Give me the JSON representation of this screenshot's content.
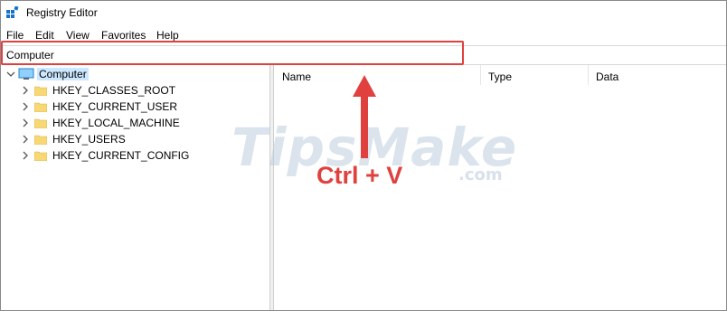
{
  "window": {
    "title": "Registry Editor"
  },
  "menu": {
    "items": [
      "File",
      "Edit",
      "View",
      "Favorites",
      "Help"
    ]
  },
  "address": {
    "value": "Computer"
  },
  "tree": {
    "root_label": "Computer",
    "keys": [
      "HKEY_CLASSES_ROOT",
      "HKEY_CURRENT_USER",
      "HKEY_LOCAL_MACHINE",
      "HKEY_USERS",
      "HKEY_CURRENT_CONFIG"
    ]
  },
  "list": {
    "columns": [
      "Name",
      "Type",
      "Data"
    ]
  },
  "annotation": {
    "text": "Ctrl + V"
  },
  "watermark": {
    "brand": "TipsMake",
    "domain": ".com"
  },
  "colors": {
    "highlight": "#e0413f",
    "selection": "#cce8ff",
    "folder": "#f8d775"
  },
  "icons": {
    "app": "registry-editor-icon",
    "computer": "computer-icon",
    "folder": "folder-icon",
    "expand": "chevron-right-icon",
    "collapse": "chevron-down-icon"
  }
}
